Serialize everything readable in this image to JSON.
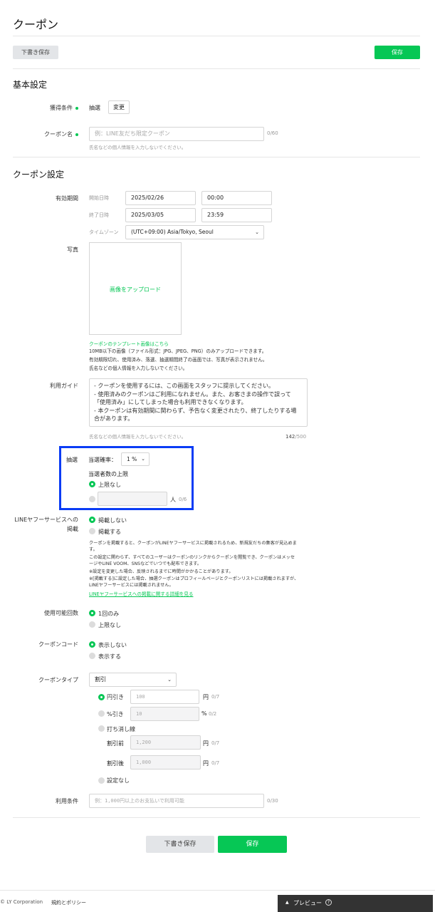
{
  "page": {
    "title": "クーポン"
  },
  "toolbar": {
    "draft_label": "下書き保存",
    "save_label": "保存"
  },
  "basic": {
    "section_title": "基本設定",
    "acquire_label": "獲得条件",
    "acquire_value": "抽選",
    "change_label": "変更",
    "name_label": "クーポン名",
    "name_placeholder": "例：LINE友だち限定クーポン",
    "name_counter": "0/60",
    "name_hint": "氏名などの個人情報を入力しないでください。"
  },
  "coupon": {
    "section_title": "クーポン設定",
    "period_label": "有効期間",
    "start_label": "開始日時",
    "start_date": "2025/02/26",
    "start_time": "00:00",
    "end_label": "終了日時",
    "end_date": "2025/03/05",
    "end_time": "23:59",
    "tz_label": "タイムゾーン",
    "tz_value": "(UTC+09:00) Asia/Tokyo, Seoul",
    "photo_label": "写真",
    "upload_label": "画像をアップロード",
    "template_link": "クーポンのテンプレート画像はこちら",
    "photo_note_1": "10MB以下の画像（ファイル形式：JPG、JPEG、PNG）のみアップロードできます。",
    "photo_note_2": "有効期限切れ、使用済み、落選、抽選期間終了の画面では、写真が表示されません。",
    "photo_note_3": "氏名などの個人情報を入力しないでください。",
    "guide_label": "利用ガイド",
    "guide_lines": [
      "- クーポンを使用するには、この画面をスタッフに提示してください。",
      "- 使用済みのクーポンはご利用になれません。また、お客さまの操作で誤って",
      "「使用済み」にしてしまった場合も利用できなくなります。",
      "- 本クーポンは有効期間に関わらず、予告なく変更されたり、終了したりする場",
      "合があります。"
    ],
    "guide_hint": "氏名などの個人情報を入力しないでください。",
    "guide_counter_num": "142",
    "guide_counter_max": "/500",
    "lottery_label": "抽選",
    "prob_label": "当選確率：",
    "prob_value": "1 %",
    "winner_limit_label": "当選者数の上限",
    "no_limit_label": "上限なし",
    "person_unit": "人",
    "person_counter": "0/6",
    "yahoo_label_1": "LINEヤフーサービスへの",
    "yahoo_label_2": "掲載",
    "yahoo_opt_no": "掲載しない",
    "yahoo_opt_yes": "掲載する",
    "yahoo_note_1": "クーポンを掲載すると、クーポンがLINEヤフーサービスに掲載されるため、新規友だちの集客が見込めま",
    "yahoo_note_2": "す。",
    "yahoo_note_3": "この設定に関わらず、すべてのユーザーはクーポンのリンクからクーポンを閲覧でき、クーポンはメッセ",
    "yahoo_note_4": "ージやLINE VOOM、SNSなどでいつでも配布できます。",
    "yahoo_note_5": "※設定を変更した場合、反映されるまでに時間がかかることがあります。",
    "yahoo_note_6": "※[掲載する]に設定した場合、抽選クーポンはプロフィールページとクーポンリストには掲載されますが、",
    "yahoo_note_7": "LINEヤフーサービスには掲載されません。",
    "yahoo_link": "LINEヤフーサービスへの掲載に関する詳細を見る",
    "usage_count_label": "使用可能回数",
    "usage_once": "1回のみ",
    "usage_unlimited": "上限なし",
    "code_label": "クーポンコード",
    "code_hide": "表示しない",
    "code_show": "表示する",
    "type_label": "クーポンタイプ",
    "type_value": "割引",
    "yen_off_label": "円引き",
    "yen_off_placeholder": "100",
    "yen_unit": "円",
    "yen_counter": "0/7",
    "pct_off_label": "%引き",
    "pct_off_placeholder": "10",
    "pct_unit": "%",
    "pct_counter": "0/2",
    "strike_label": "打ち消し線",
    "before_label": "割引前",
    "before_placeholder": "1,200",
    "after_label": "割引後",
    "after_placeholder": "1,000",
    "no_setting_label": "設定なし",
    "terms_label": "利用条件",
    "terms_placeholder": "例：1,000円以上のお支払いで利用可能",
    "terms_counter": "0/30"
  },
  "bottom": {
    "draft_label": "下書き保存",
    "save_label": "保存"
  },
  "footer": {
    "copyright": "© LY Corporation",
    "policy_link": "規約とポリシー",
    "preview_label": "プレビュー"
  },
  "colors": {
    "accent": "#06c755",
    "highlight": "#0a3cf5"
  }
}
